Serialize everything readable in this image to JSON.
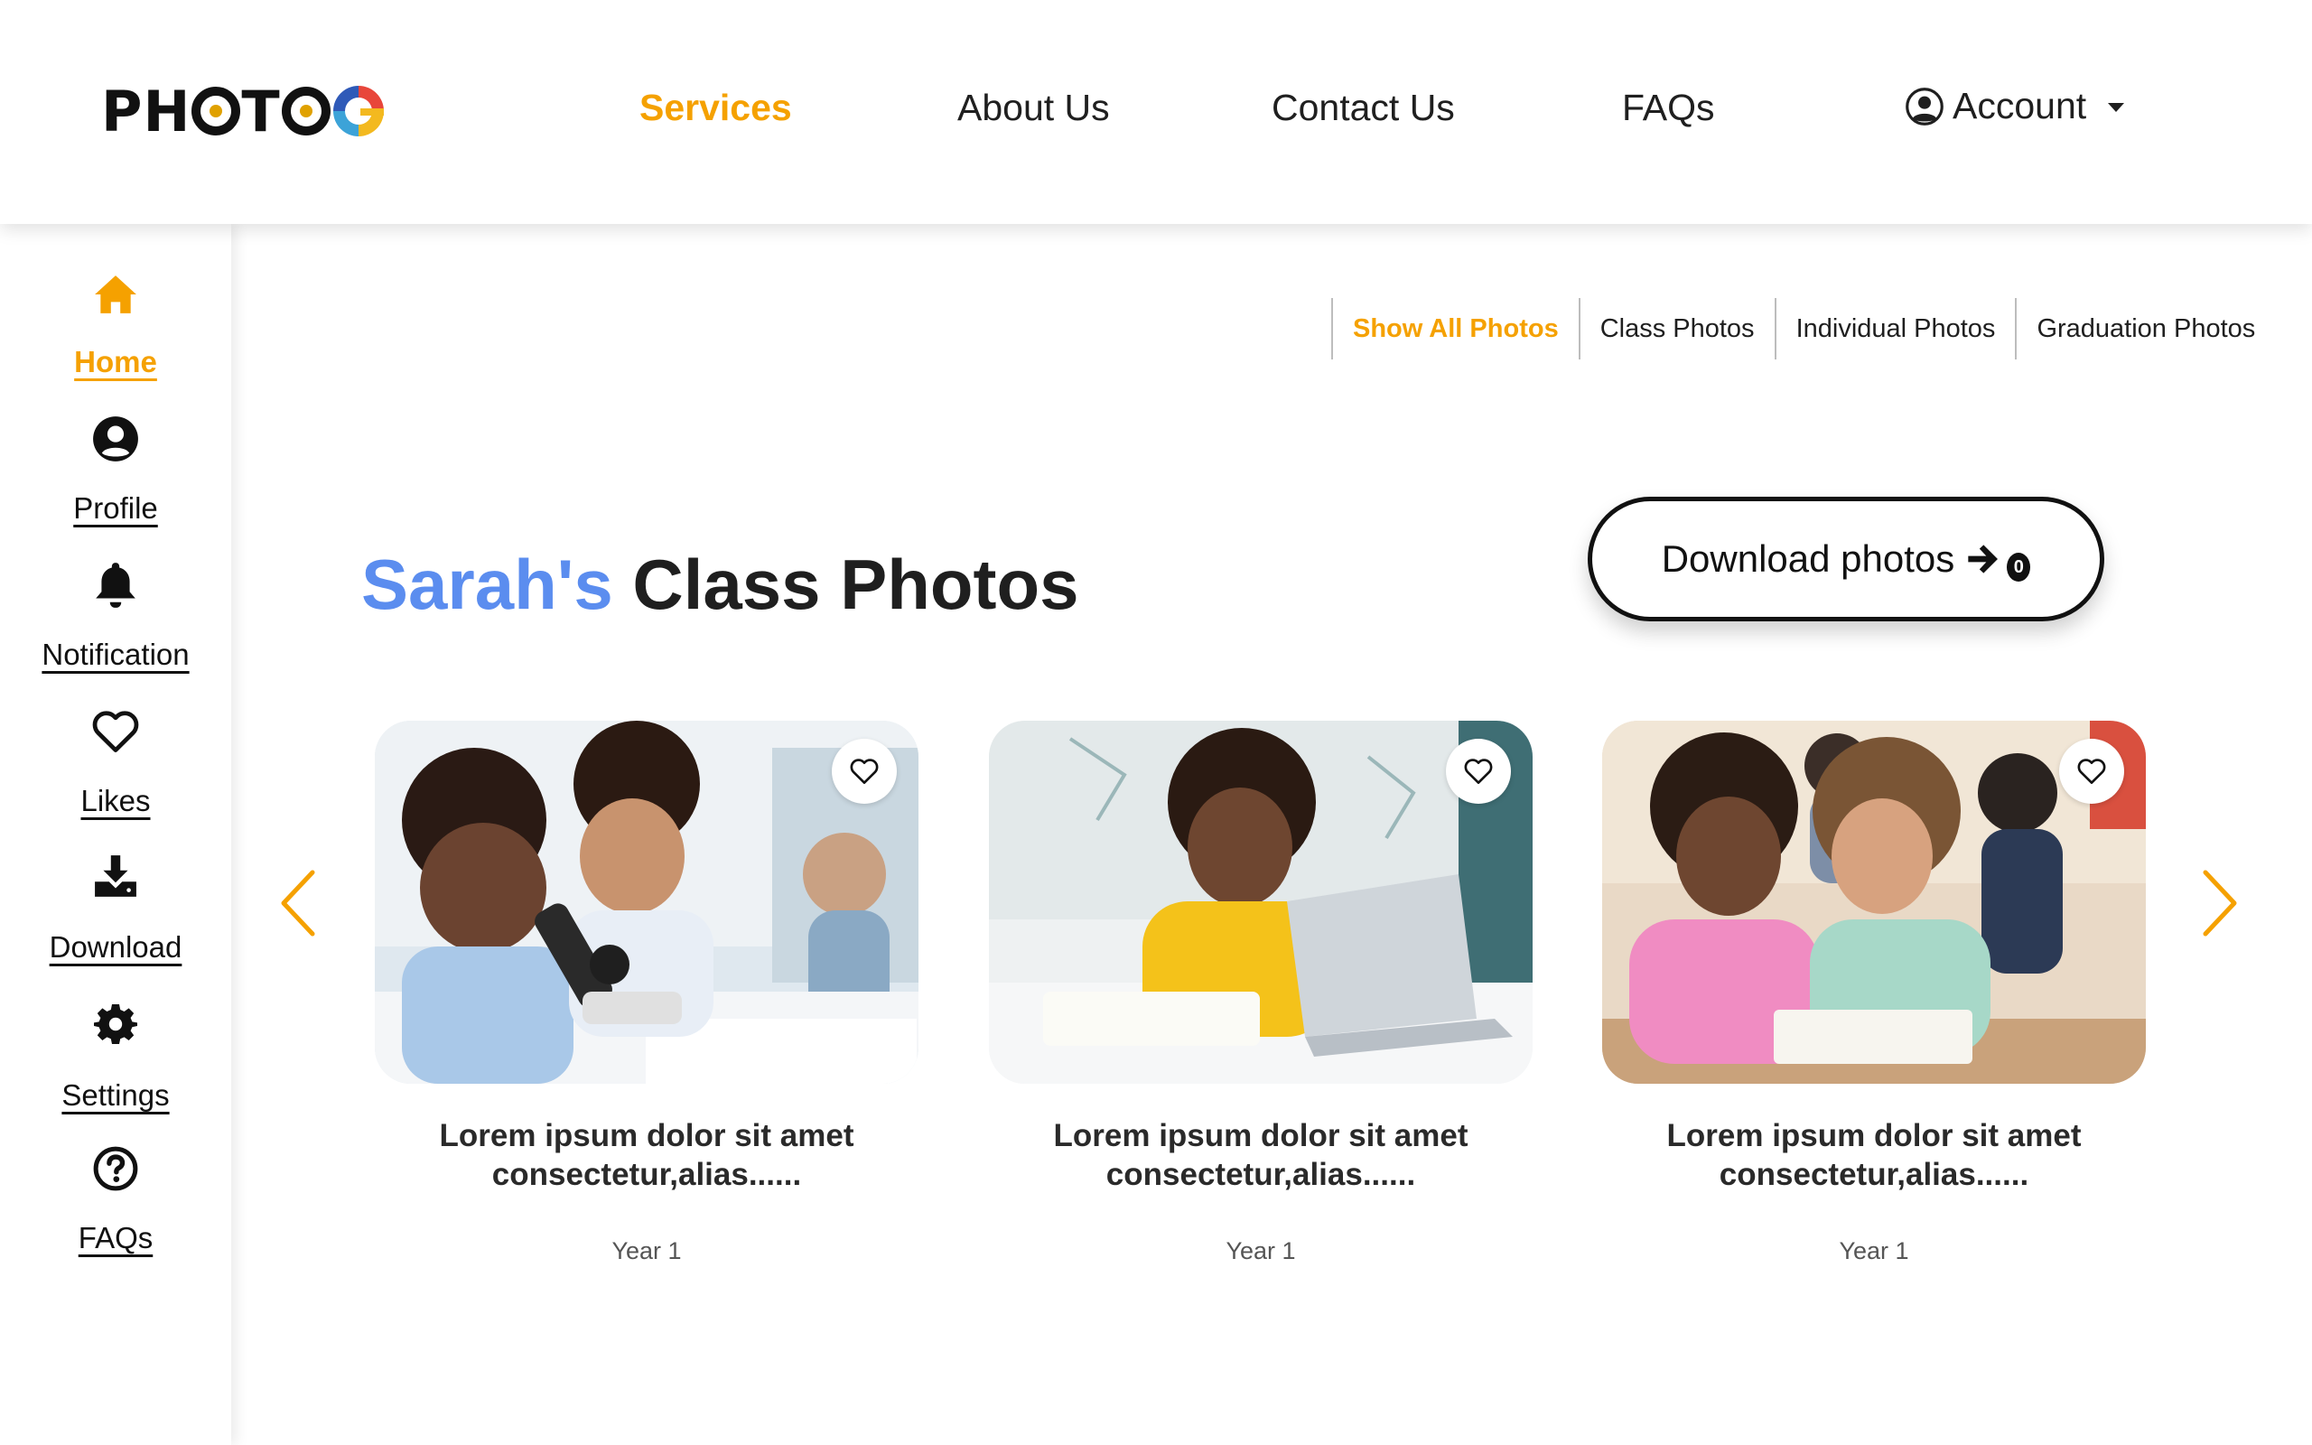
{
  "header": {
    "logo_text": "PHOTOG",
    "nav": [
      {
        "label": "Services",
        "active": true
      },
      {
        "label": "About Us",
        "active": false
      },
      {
        "label": "Contact Us",
        "active": false
      },
      {
        "label": "FAQs",
        "active": false
      }
    ],
    "account_label": "Account",
    "account_icon": "user-circle-icon"
  },
  "sidebar": {
    "items": [
      {
        "label": "Home",
        "icon": "home-icon",
        "active": true
      },
      {
        "label": "Profile",
        "icon": "user-circle-icon",
        "active": false
      },
      {
        "label": "Notification",
        "icon": "bell-icon",
        "active": false
      },
      {
        "label": "Likes",
        "icon": "heart-icon",
        "active": false
      },
      {
        "label": "Download",
        "icon": "download-icon",
        "active": false
      },
      {
        "label": "Settings",
        "icon": "gear-icon",
        "active": false
      },
      {
        "label": "FAQs",
        "icon": "question-circle-icon",
        "active": false
      }
    ]
  },
  "filters": {
    "tabs": [
      {
        "label": "Show All Photos",
        "active": true
      },
      {
        "label": "Class Photos",
        "active": false
      },
      {
        "label": "Individual Photos",
        "active": false
      },
      {
        "label": "Graduation Photos",
        "active": false
      }
    ]
  },
  "main": {
    "title_name": "Sarah's",
    "title_rest": "Class Photos",
    "download_label": "Download photos",
    "download_count": "0",
    "cards": [
      {
        "text": "Lorem ipsum dolor sit amet consectetur,alias......",
        "year": "Year 1",
        "photo": "students-microscope-photo"
      },
      {
        "text": "Lorem ipsum dolor sit amet consectetur,alias......",
        "year": "Year 1",
        "photo": "student-laptop-photo"
      },
      {
        "text": "Lorem ipsum dolor sit amet consectetur,alias......",
        "year": "Year 1",
        "photo": "students-reading-photo"
      }
    ]
  },
  "colors": {
    "accent": "#f5a100",
    "name_blue": "#5b8def",
    "text": "#1f1f1f"
  }
}
